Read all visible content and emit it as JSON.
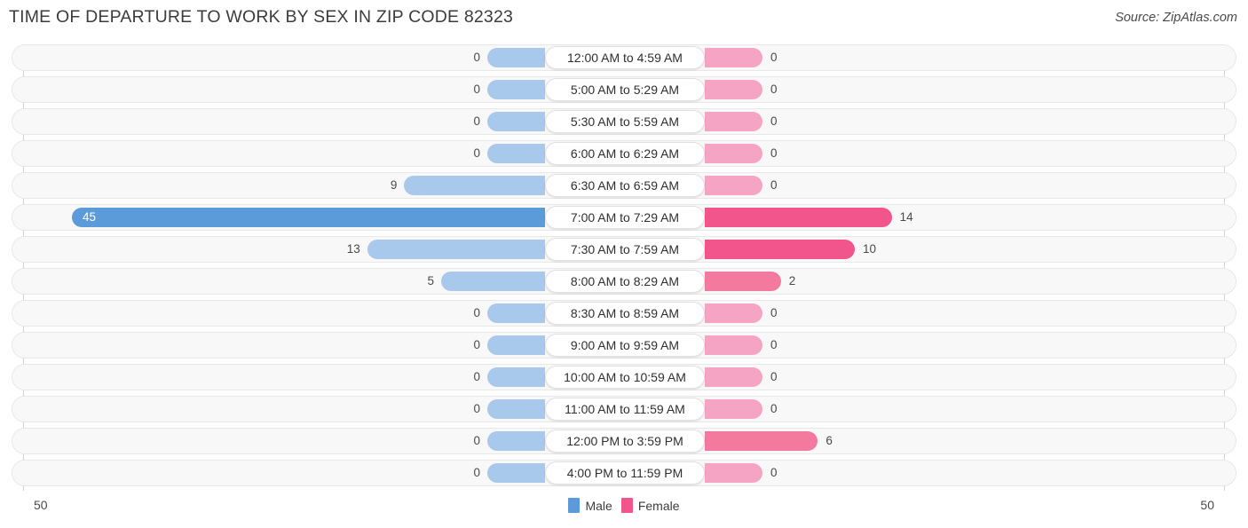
{
  "header": {
    "title": "TIME OF DEPARTURE TO WORK BY SEX IN ZIP CODE 82323",
    "source": "Source: ZipAtlas.com"
  },
  "axis": {
    "left_tick": "50",
    "right_tick": "50"
  },
  "legend": {
    "male_label": "Male",
    "female_label": "Female",
    "male_color": "#5b9bd9",
    "female_color": "#f2558c"
  },
  "colors": {
    "male_light": "#a8c8ec",
    "male_strong": "#5b9bd9",
    "female_light": "#f5a5c3",
    "female_mid": "#f4799f",
    "female_strong": "#f2558c",
    "row_background": "#f8f8f8",
    "row_border": "#e8e8e8"
  },
  "chart_data": {
    "type": "bar",
    "orientation": "horizontal-diverging",
    "title": "TIME OF DEPARTURE TO WORK BY SEX IN ZIP CODE 82323",
    "xlabel": "",
    "ylabel": "",
    "xlim": [
      50,
      50
    ],
    "grid": false,
    "legend_position": "bottom-center",
    "categories": [
      "12:00 AM to 4:59 AM",
      "5:00 AM to 5:29 AM",
      "5:30 AM to 5:59 AM",
      "6:00 AM to 6:29 AM",
      "6:30 AM to 6:59 AM",
      "7:00 AM to 7:29 AM",
      "7:30 AM to 7:59 AM",
      "8:00 AM to 8:29 AM",
      "8:30 AM to 8:59 AM",
      "9:00 AM to 9:59 AM",
      "10:00 AM to 10:59 AM",
      "11:00 AM to 11:59 AM",
      "12:00 PM to 3:59 PM",
      "4:00 PM to 11:59 PM"
    ],
    "series": [
      {
        "name": "Male",
        "values": [
          0,
          0,
          0,
          0,
          9,
          45,
          13,
          5,
          0,
          0,
          0,
          0,
          0,
          0
        ]
      },
      {
        "name": "Female",
        "values": [
          0,
          0,
          0,
          0,
          0,
          14,
          10,
          2,
          0,
          0,
          0,
          0,
          6,
          0
        ]
      }
    ]
  },
  "rows": [
    {
      "label": "12:00 AM to 4:59 AM",
      "male": "0",
      "female": "0",
      "male_style": "",
      "female_style": ""
    },
    {
      "label": "5:00 AM to 5:29 AM",
      "male": "0",
      "female": "0",
      "male_style": "",
      "female_style": ""
    },
    {
      "label": "5:30 AM to 5:59 AM",
      "male": "0",
      "female": "0",
      "male_style": "",
      "female_style": ""
    },
    {
      "label": "6:00 AM to 6:29 AM",
      "male": "0",
      "female": "0",
      "male_style": "",
      "female_style": ""
    },
    {
      "label": "6:30 AM to 6:59 AM",
      "male": "9",
      "female": "0",
      "male_style": "",
      "female_style": ""
    },
    {
      "label": "7:00 AM to 7:29 AM",
      "male": "45",
      "female": "14",
      "male_style": "hi",
      "female_style": "hi"
    },
    {
      "label": "7:30 AM to 7:59 AM",
      "male": "13",
      "female": "10",
      "male_style": "",
      "female_style": "hi"
    },
    {
      "label": "8:00 AM to 8:29 AM",
      "male": "5",
      "female": "2",
      "male_style": "",
      "female_style": "mid"
    },
    {
      "label": "8:30 AM to 8:59 AM",
      "male": "0",
      "female": "0",
      "male_style": "",
      "female_style": ""
    },
    {
      "label": "9:00 AM to 9:59 AM",
      "male": "0",
      "female": "0",
      "male_style": "",
      "female_style": ""
    },
    {
      "label": "10:00 AM to 10:59 AM",
      "male": "0",
      "female": "0",
      "male_style": "",
      "female_style": ""
    },
    {
      "label": "11:00 AM to 11:59 AM",
      "male": "0",
      "female": "0",
      "male_style": "",
      "female_style": ""
    },
    {
      "label": "12:00 PM to 3:59 PM",
      "male": "0",
      "female": "6",
      "male_style": "",
      "female_style": "mid"
    },
    {
      "label": "4:00 PM to 11:59 PM",
      "male": "0",
      "female": "0",
      "male_style": "",
      "female_style": ""
    }
  ]
}
